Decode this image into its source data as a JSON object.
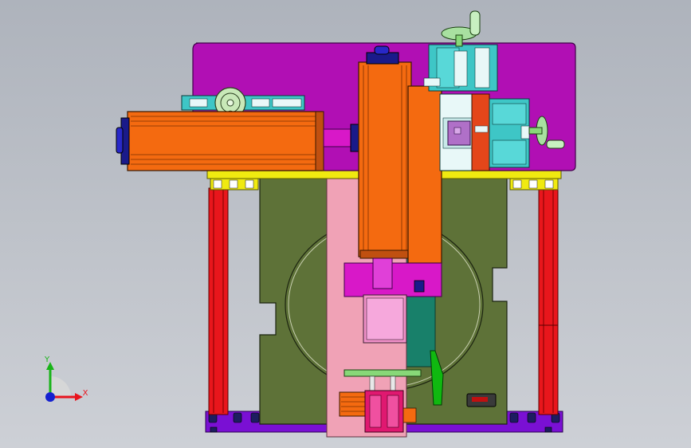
{
  "triad": {
    "x_label": "X",
    "y_label": "Y",
    "x_color": "#e8141e",
    "y_color": "#18b418",
    "z_color": "#1420d0"
  },
  "palette": {
    "background": "#bfc3ca",
    "plate_magenta": "#b10fb4",
    "motor_orange": "#f46a10",
    "base_olive": "#5e7238",
    "rail_red": "#e8161c",
    "rail_yellow": "#f0ea10",
    "column_pink": "#f0a2b6",
    "block_cyan": "#3ec6c6",
    "base_purple": "#7a10d4",
    "teal": "#18806a"
  }
}
